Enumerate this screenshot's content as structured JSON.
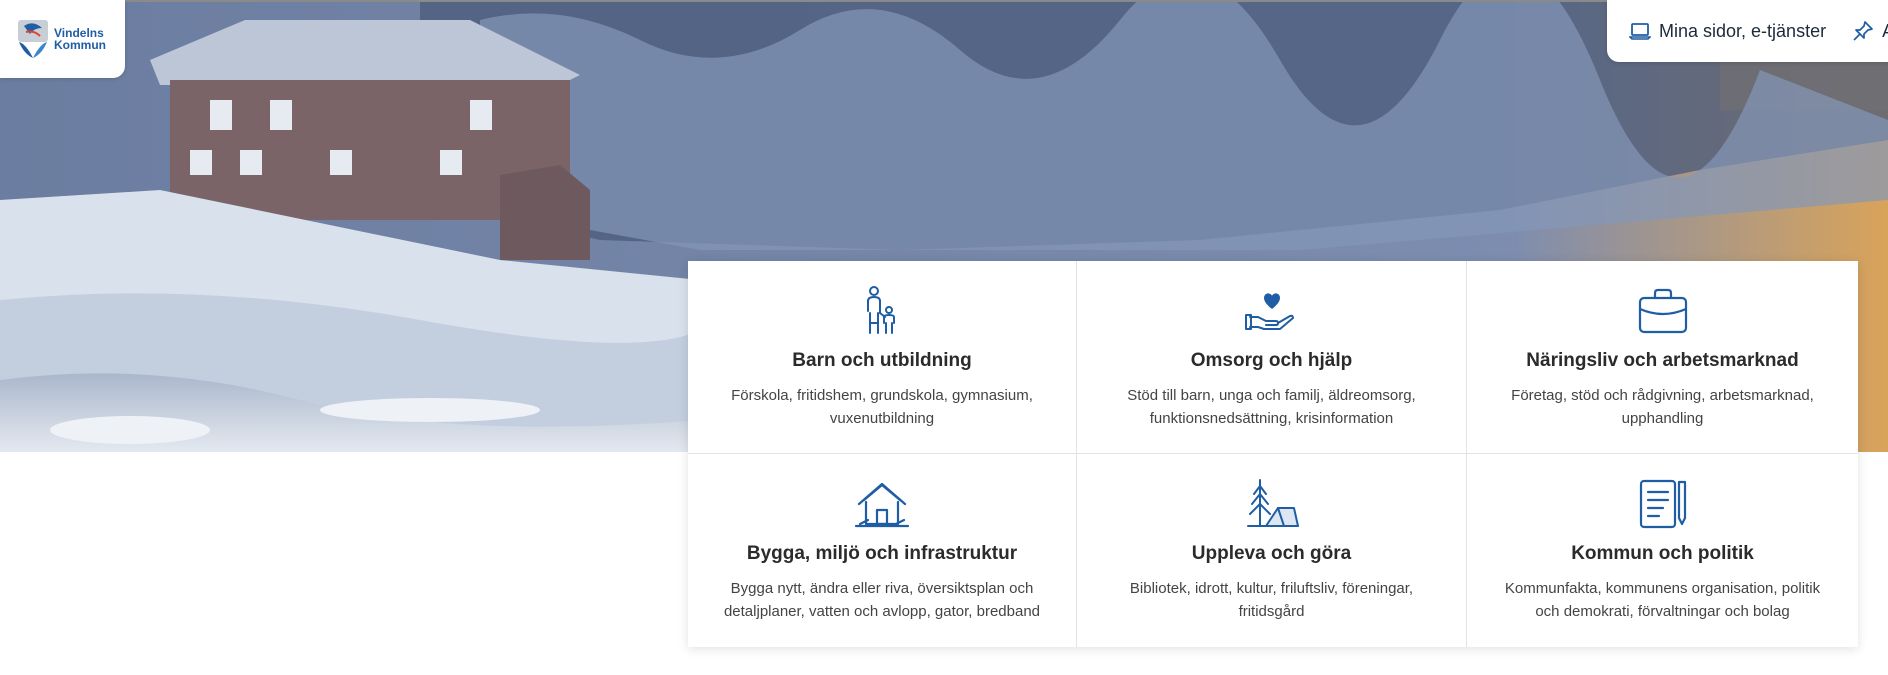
{
  "header": {
    "logo_line1": "Vindelns",
    "logo_line2": "Kommun",
    "links": [
      {
        "label": "Mina sidor, e-tjänster",
        "icon": "laptop-icon"
      },
      {
        "label": "A",
        "icon": "pin-icon"
      }
    ]
  },
  "cards": [
    {
      "title": "Barn och utbildning",
      "desc": "Förskola, fritidshem, grundskola, gymnasium, vuxenutbildning",
      "icon": "parent-child-icon"
    },
    {
      "title": "Omsorg och hjälp",
      "desc": "Stöd till barn, unga och familj, äldreomsorg, funktionsnedsättning, krisinformation",
      "icon": "heart-hand-icon"
    },
    {
      "title": "Näringsliv och arbetsmarknad",
      "desc": "Företag, stöd och rådgivning, arbetsmarknad, upphandling",
      "icon": "briefcase-icon"
    },
    {
      "title": "Bygga, miljö och infrastruktur",
      "desc": "Bygga nytt, ändra eller riva, översiktsplan och detaljplaner, vatten och avlopp, gator, bredband",
      "icon": "house-icon"
    },
    {
      "title": "Uppleva och göra",
      "desc": "Bibliotek, idrott, kultur, friluftsliv, föreningar, fritidsgård",
      "icon": "tree-tent-icon"
    },
    {
      "title": "Kommun och politik",
      "desc": "Kommunfakta, kommunens organisation, politik och demokrati, förvaltningar och bolag",
      "icon": "document-pen-icon"
    }
  ],
  "colors": {
    "accent": "#1f5da4",
    "text": "#2b2b2b"
  }
}
